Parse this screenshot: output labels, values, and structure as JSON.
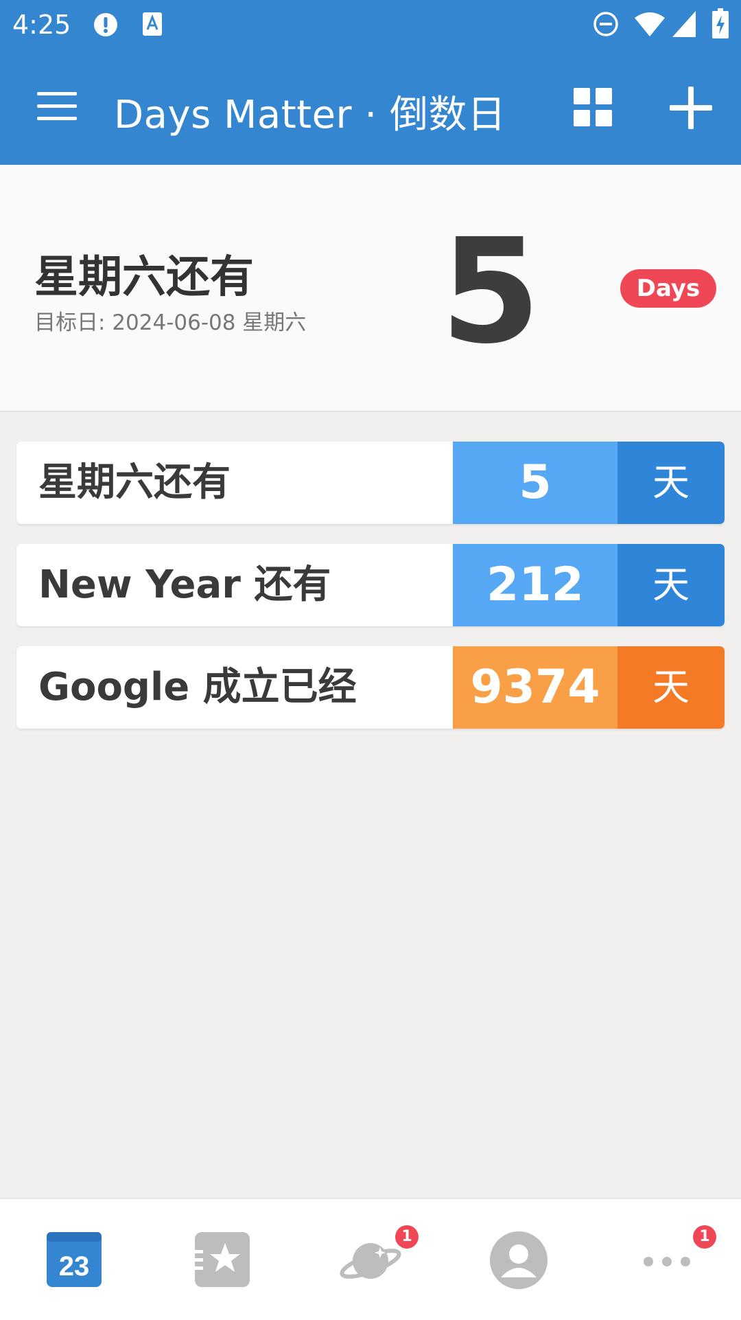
{
  "status_bar": {
    "time": "4:25"
  },
  "app_bar": {
    "title": "Days Matter · 倒数日",
    "icons": [
      "menu-icon",
      "grid-icon",
      "add-icon"
    ]
  },
  "hero": {
    "title": "星期六还有",
    "subtitle": "目标日: 2024-06-08 星期六",
    "number": "5",
    "badge": "Days"
  },
  "events": [
    {
      "label": "星期六还有",
      "count": "5",
      "unit": "天",
      "count_color": "#56a8f5",
      "unit_color": "#2f86d8"
    },
    {
      "label": "New Year 还有",
      "count": "212",
      "unit": "天",
      "count_color": "#56a8f5",
      "unit_color": "#2f86d8"
    },
    {
      "label": "Google 成立已经",
      "count": "9374",
      "unit": "天",
      "count_color": "#f9a046",
      "unit_color": "#f57a26"
    }
  ],
  "bottom_nav": {
    "items": [
      {
        "icon": "calendar-icon",
        "text": "23",
        "active": true
      },
      {
        "icon": "star-list-icon"
      },
      {
        "icon": "planet-icon",
        "badge": "1"
      },
      {
        "icon": "profile-icon"
      },
      {
        "icon": "more-icon",
        "badge": "1"
      }
    ]
  },
  "colors": {
    "primary": "#3586d1",
    "accent_red": "#f04756",
    "background": "#f1f0ee"
  }
}
